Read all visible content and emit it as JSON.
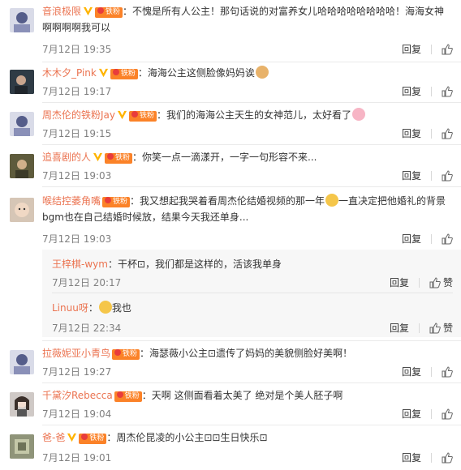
{
  "comments": [
    {
      "username": "音浪极限",
      "fan_label": "铁粉",
      "text": "：不愧是所有人公主！那句话说的对富养女儿哈哈哈哈哈哈哈哈！海海女神",
      "text2": "啊啊啊啊我可以",
      "time": "7月12日 19:35",
      "reply": "回复",
      "avatar_color": "#d9dbe8"
    },
    {
      "username": "木木夕_Pink",
      "fan_label": "铁粉",
      "text": "：海海公主这侧脸像妈妈诶",
      "time": "7月12日 19:17",
      "reply": "回复",
      "avatar_color": "#3c4a52"
    },
    {
      "username": "周杰伦的铁粉Jay",
      "fan_label": "铁粉",
      "text": "：我们的海海公主天生的女神范儿，太好看了",
      "time": "7月12日 19:15",
      "reply": "回复",
      "avatar_color": "#d9dbe8"
    },
    {
      "username": "追喜剧的人",
      "fan_label": "铁粉",
      "text": "：你笑一点一滴漾开，一字一句形容不来...",
      "time": "7月12日 19:03",
      "reply": "回复",
      "avatar_color": "#6b6a4a"
    },
    {
      "username": "喉结控萎角嘴",
      "fan_label": "铁粉",
      "text": "：我又想起我哭着看周杰伦结婚视频的那一年",
      "text_after_emoji": "一直决定把他婚礼的背景",
      "text2": "bgm也在自己结婚时候放，结果今天我还单身...",
      "time": "7月12日 19:03",
      "reply": "回复",
      "avatar_color": "#c9b8a8"
    },
    {
      "username": "拉薇妮亚小青鸟",
      "fan_label": "铁粉",
      "text": "：海瑟薇小公主⊡遗传了妈妈的美貌侧脸好美啊！",
      "time": "7月12日 19:27",
      "reply": "回复",
      "avatar_color": "#d9dbe8"
    },
    {
      "username": "千黛汐Rebecca",
      "fan_label": "铁粉",
      "text": "：天啊 这侧面看着太美了 绝对是个美人胚子啊",
      "time": "7月12日 19:04",
      "reply": "回复",
      "avatar_color": "#c8c4c2"
    },
    {
      "username": "爸-爸",
      "fan_label": "铁粉",
      "text": "：周杰伦昆凌的小公主⊡⊡生日快乐⊡",
      "time": "7月12日 19:01",
      "reply": "回复",
      "avatar_color": "#8a8f76"
    }
  ],
  "subreplies": [
    {
      "username": "王梓棋-wym",
      "text": "：干杯⊡，我们都是这样的，活该我单身",
      "time": "7月12日 20:17",
      "reply": "回复",
      "like": "赞"
    },
    {
      "username": "Linuu呀",
      "text": "：",
      "text_after_emoji": "我也",
      "time": "7月12日 22:34",
      "reply": "回复",
      "like": "赞"
    }
  ],
  "colors": {
    "username": "#eb7350",
    "meta": "#808080",
    "fan_badge": "#fb8228",
    "vip": "#ffb400"
  }
}
